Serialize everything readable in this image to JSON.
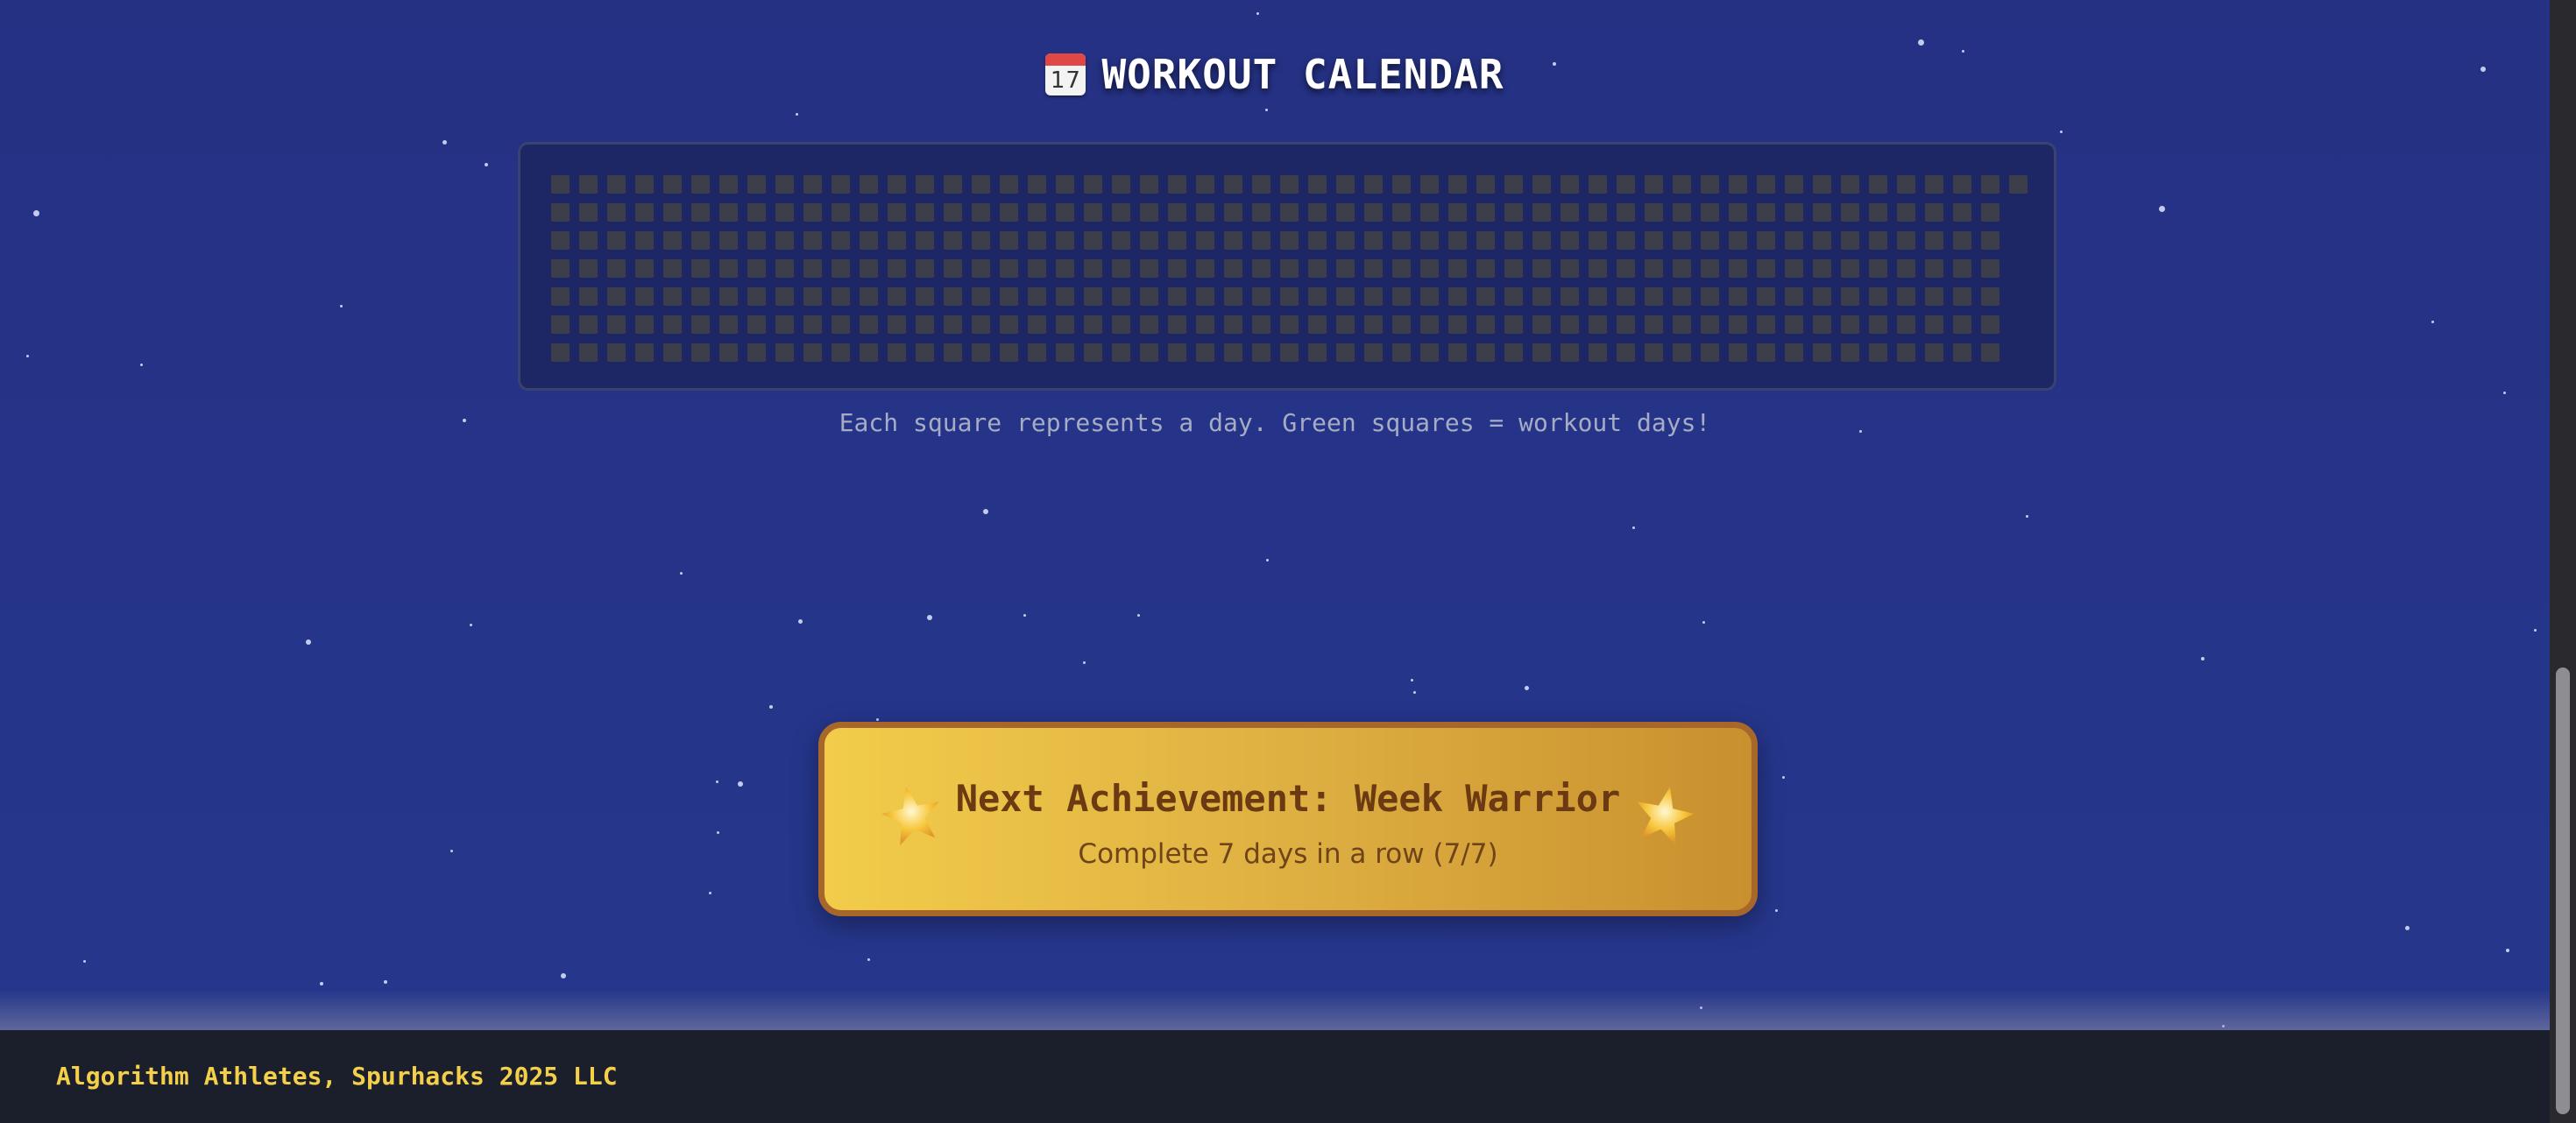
{
  "calendar": {
    "icon_text": "17",
    "title": "WORKOUT CALENDAR",
    "caption": "Each square represents a day. Green squares = workout days!",
    "rows": 7,
    "columns": 53,
    "total_days": 365,
    "empty_color": "#3c3f49",
    "workout_color": "#3fbf5f",
    "workout_days": 0
  },
  "achievement": {
    "title": "Next Achievement: Week Warrior",
    "subtitle": "Complete 7 days in a row (7/7)",
    "icon": "star-icon"
  },
  "footer": {
    "text": "Algorithm Athletes, Spurhacks 2025 LLC"
  },
  "colors": {
    "background": "#243385",
    "accent": "#f4cf4a",
    "achievement_border": "#a8672a"
  }
}
